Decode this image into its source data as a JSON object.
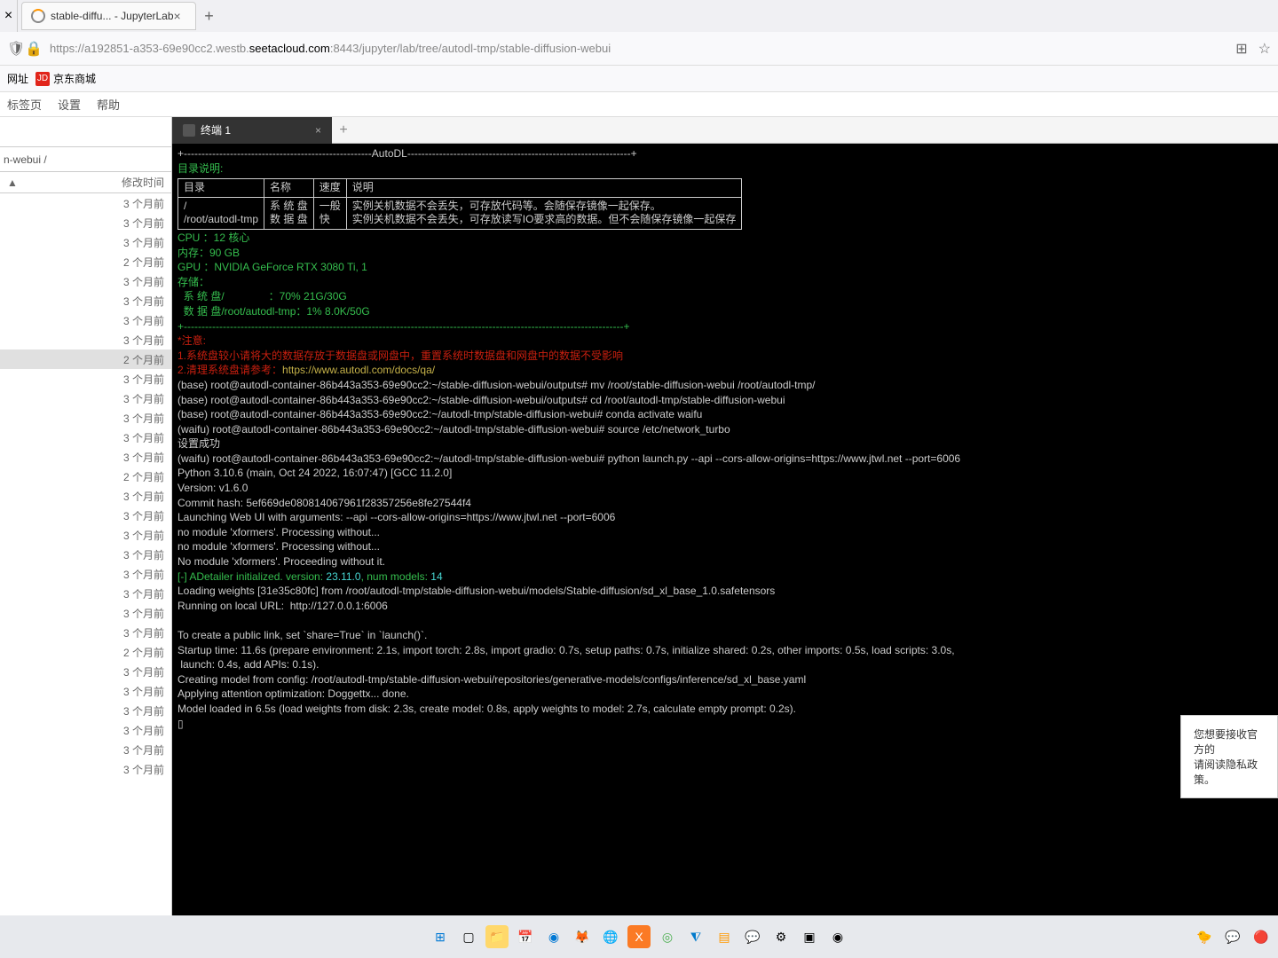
{
  "browser": {
    "tab_title": "stable-diffu... - JupyterLab",
    "url_pre": "https://a192851-a353-69e90cc2.westb.",
    "url_domain": "seetacloud.com",
    "url_post": ":8443/jupyter/lab/tree/autodl-tmp/stable-diffusion-webui"
  },
  "bookmarks": {
    "b1": "网址",
    "jd": "京东商城"
  },
  "menu": {
    "m1": "标签页",
    "m2": "设置",
    "m3": "帮助"
  },
  "filebrowser": {
    "breadcrumb": "n-webui /",
    "col_time": "修改时间",
    "sort_icon": "▲",
    "rows": [
      {
        "time": "3 个月前"
      },
      {
        "time": "3 个月前"
      },
      {
        "time": "3 个月前"
      },
      {
        "time": "2 个月前"
      },
      {
        "time": "3 个月前"
      },
      {
        "time": "3 个月前"
      },
      {
        "time": "3 个月前"
      },
      {
        "time": "3 个月前"
      },
      {
        "time": "2 个月前",
        "selected": true
      },
      {
        "time": "3 个月前"
      },
      {
        "time": "3 个月前"
      },
      {
        "time": "3 个月前"
      },
      {
        "time": "3 个月前"
      },
      {
        "time": "3 个月前"
      },
      {
        "time": "2 个月前"
      },
      {
        "time": "3 个月前"
      },
      {
        "time": "3 个月前"
      },
      {
        "time": "3 个月前"
      },
      {
        "time": "3 个月前"
      },
      {
        "time": "3 个月前"
      },
      {
        "time": "3 个月前"
      },
      {
        "time": "3 个月前"
      },
      {
        "time": "3 个月前"
      },
      {
        "time": "2 个月前"
      },
      {
        "time": "3 个月前"
      },
      {
        "time": "3 个月前"
      },
      {
        "time": "3 个月前"
      },
      {
        "time": "3 个月前"
      },
      {
        "time": "3 个月前"
      },
      {
        "time": "3 个月前"
      }
    ]
  },
  "worktab": {
    "title": "终端 1"
  },
  "terminal": {
    "header_dash": "+-----------------------------------------------------AutoDL---------------------------------------------------------------+",
    "dir_label": "目录说明:",
    "tbl_h1": "目录",
    "tbl_h2": "名称",
    "tbl_h3": "速度",
    "tbl_h4": "说明",
    "tbl_r1c1": "/",
    "tbl_r1c2": "系 统 盘",
    "tbl_r1c3": "一般",
    "tbl_r1c4": "实例关机数据不会丢失，可存放代码等。会随保存镜像一起保存。",
    "tbl_r2c1": "/root/autodl-tmp",
    "tbl_r2c2": "数 据 盘",
    "tbl_r2c3": "快",
    "tbl_r2c4": "实例关机数据不会丢失，可存放读写IO要求高的数据。但不会随保存镜像一起保存",
    "cpu": "CPU ：12 核心",
    "mem": "内存：90 GB",
    "gpu": "GPU ：NVIDIA GeForce RTX 3080 Ti, 1",
    "storage_label": "存储：",
    "sys_disk": "  系 统 盘/               ：70% 21G/30G",
    "data_disk": "  数 据 盘/root/autodl-tmp：1% 8.0K/50G",
    "dash2": "+----------------------------------------------------------------------------------------------------------------------------+",
    "note_label": "*注意:",
    "note1": "1.系统盘较小请将大的数据存放于数据盘或网盘中，重置系统时数据盘和网盘中的数据不受影响",
    "note2_a": "2.清理系统盘请参考：",
    "note2_b": "https://www.autodl.com/docs/qa/",
    "l1": "(base) root@autodl-container-86b443a353-69e90cc2:~/stable-diffusion-webui/outputs# mv /root/stable-diffusion-webui /root/autodl-tmp/",
    "l2": "(base) root@autodl-container-86b443a353-69e90cc2:~/stable-diffusion-webui/outputs# cd /root/autodl-tmp/stable-diffusion-webui",
    "l3": "(base) root@autodl-container-86b443a353-69e90cc2:~/autodl-tmp/stable-diffusion-webui# conda activate waifu",
    "l4": "(waifu) root@autodl-container-86b443a353-69e90cc2:~/autodl-tmp/stable-diffusion-webui# source /etc/network_turbo",
    "l5": "设置成功",
    "l6": "(waifu) root@autodl-container-86b443a353-69e90cc2:~/autodl-tmp/stable-diffusion-webui# python launch.py --api --cors-allow-origins=https://www.jtwl.net --port=6006",
    "l7": "Python 3.10.6 (main, Oct 24 2022, 16:07:47) [GCC 11.2.0]",
    "l8": "Version: v1.6.0",
    "l9": "Commit hash: 5ef669de080814067961f28357256e8fe27544f4",
    "l10": "Launching Web UI with arguments: --api --cors-allow-origins=https://www.jtwl.net --port=6006",
    "l11": "no module 'xformers'. Processing without...",
    "l12": "no module 'xformers'. Processing without...",
    "l13": "No module 'xformers'. Proceeding without it.",
    "l14a": "[-] ADetailer initialized. version: ",
    "l14b": "23.11.0",
    "l14c": ", num models: ",
    "l14d": "14",
    "l15": "Loading weights [31e35c80fc] from /root/autodl-tmp/stable-diffusion-webui/models/Stable-diffusion/sd_xl_base_1.0.safetensors",
    "l16": "Running on local URL:  http://127.0.0.1:6006",
    "l17": "",
    "l18": "To create a public link, set `share=True` in `launch()`.",
    "l19": "Startup time: 11.6s (prepare environment: 2.1s, import torch: 2.8s, import gradio: 0.7s, setup paths: 0.7s, initialize shared: 0.2s, other imports: 0.5s, load scripts: 3.0s,",
    "l20": " launch: 0.4s, add APIs: 0.1s).",
    "l21": "Creating model from config: /root/autodl-tmp/stable-diffusion-webui/repositories/generative-models/configs/inference/sd_xl_base.yaml",
    "l22": "Applying attention optimization: Doggettx... done.",
    "l23": "Model loaded in 6.5s (load weights from disk: 2.3s, create model: 0.8s, apply weights to model: 2.7s, calculate empty prompt: 0.2s).",
    "cursor": "▯"
  },
  "notif": {
    "line1": "您想要接收官方的",
    "line2": "请阅读隐私政策。"
  }
}
